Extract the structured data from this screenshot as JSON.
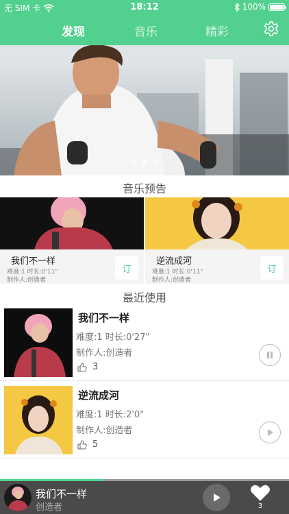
{
  "status": {
    "carrier": "无 SIM 卡",
    "time": "18:12",
    "battery": "100%"
  },
  "nav": {
    "tabs": [
      "发现",
      "音乐",
      "精彩"
    ],
    "active": 0,
    "settings_icon": "gear-icon"
  },
  "banner": {
    "slide_count": 3,
    "active_slide": 1
  },
  "preview": {
    "title": "音乐预告",
    "items": [
      {
        "title": "我们不一样",
        "difficulty": "难度:1  时长:0'11\"",
        "creator": "制作人:创造者",
        "subscribe": "订"
      },
      {
        "title": "逆流成河",
        "difficulty": "难度:1  时长:0'11\"",
        "creator": "制作人:创造者",
        "subscribe": "订"
      }
    ]
  },
  "recent": {
    "title": "最近使用",
    "items": [
      {
        "title": "我们不一样",
        "info": "难度:1  时长:0'27\"",
        "creator": "制作人:创造者",
        "likes": "3",
        "state": "pause"
      },
      {
        "title": "逆流成河",
        "info": "难度:1  时长:2'0\"",
        "creator": "制作人:创造者",
        "likes": "5",
        "state": "play"
      }
    ]
  },
  "player": {
    "title": "我们不一样",
    "artist": "创造者",
    "favorites": "3",
    "progress": 0.36
  },
  "colors": {
    "accent": "#52d08f",
    "player_bg": "#4a4a4a"
  }
}
